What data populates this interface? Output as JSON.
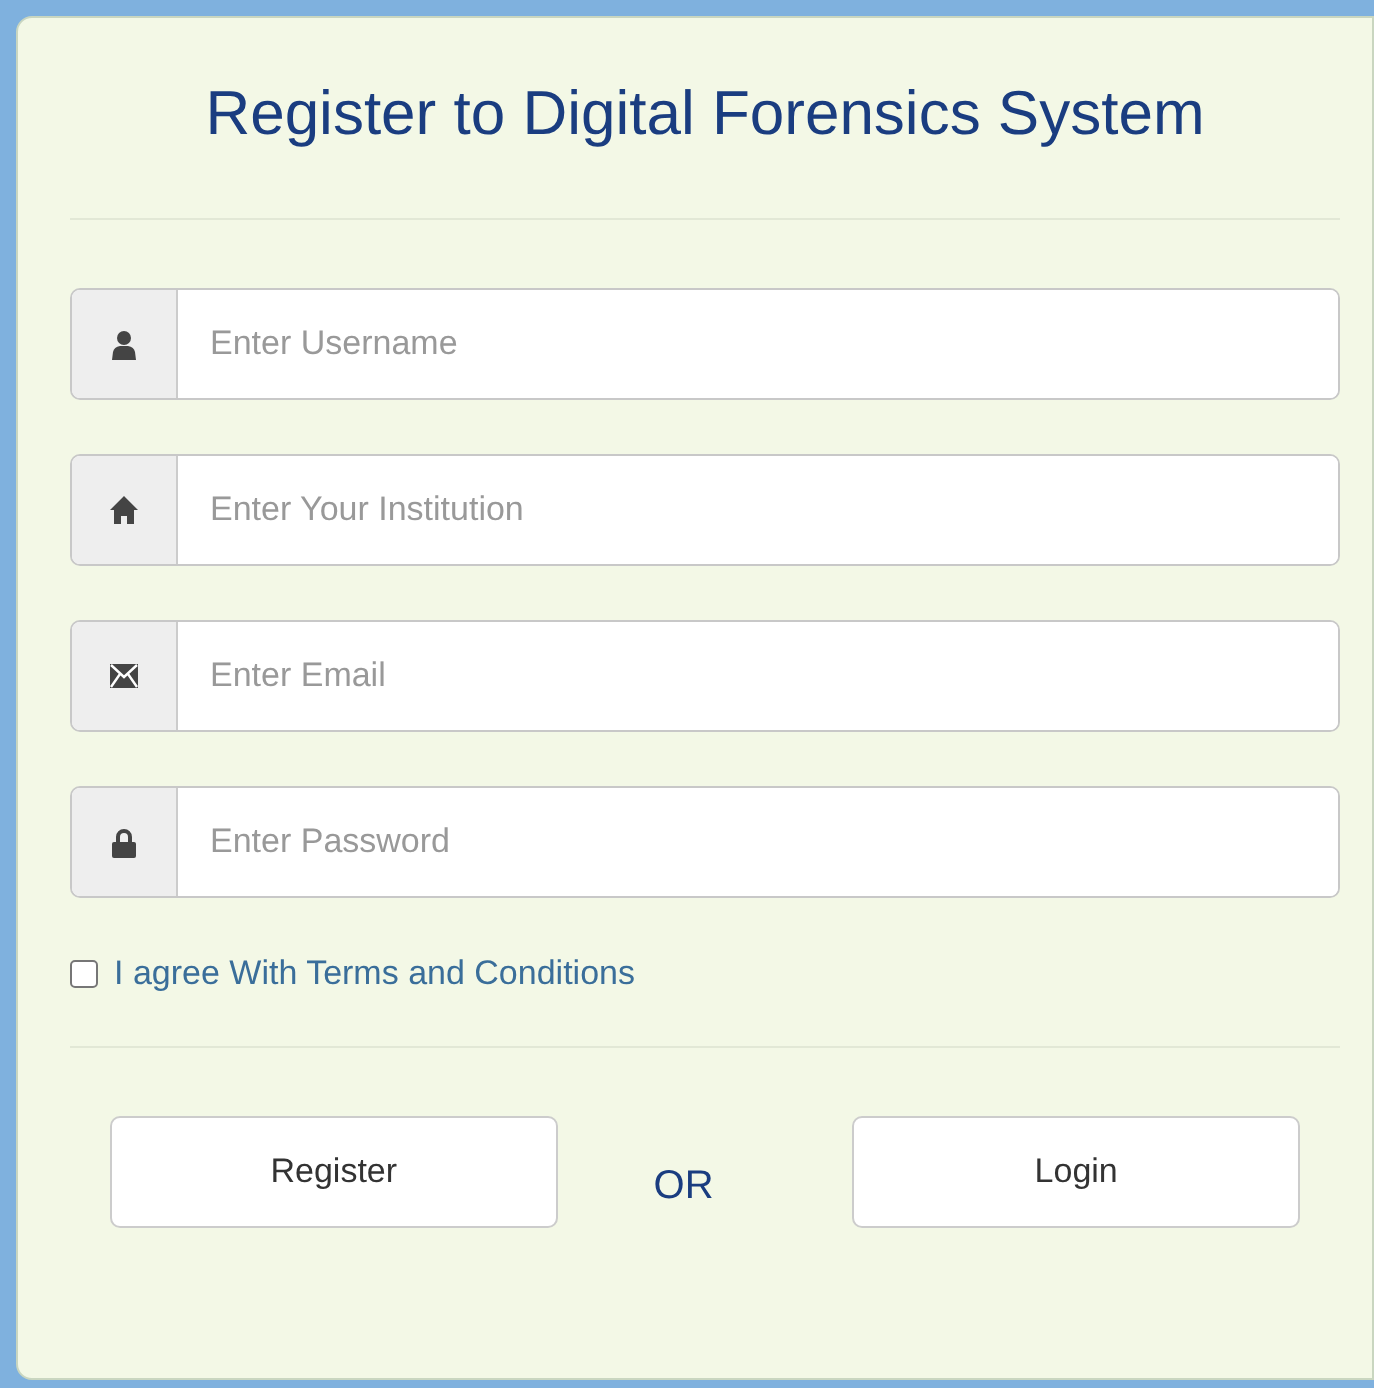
{
  "title": "Register to Digital Forensics System",
  "fields": [
    {
      "kind": "username",
      "placeholder": "Enter Username"
    },
    {
      "kind": "institution",
      "placeholder": "Enter Your Institution"
    },
    {
      "kind": "email",
      "placeholder": "Enter Email"
    },
    {
      "kind": "password",
      "placeholder": "Enter Password"
    }
  ],
  "terms": {
    "label": "I agree With Terms and Conditions",
    "checked": false
  },
  "buttons": {
    "primary": "Register",
    "separator": "OR",
    "secondary": "Login"
  }
}
